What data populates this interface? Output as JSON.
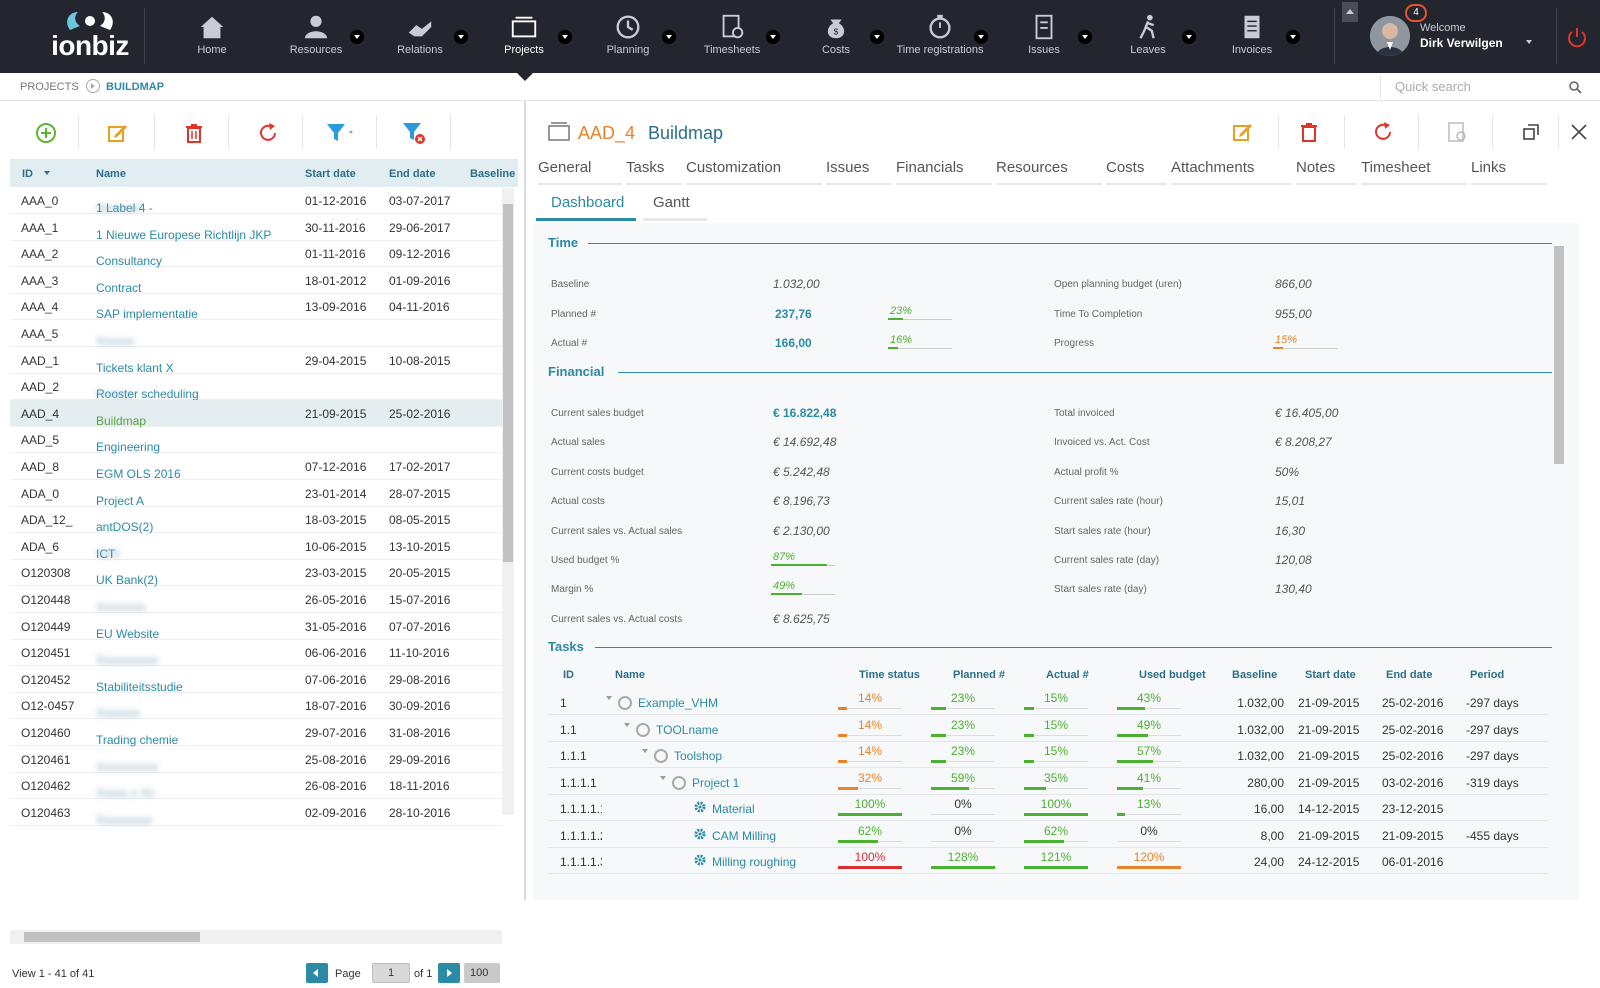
{
  "app": {
    "logo_text": "ionbiz"
  },
  "nav": [
    {
      "label": "Home",
      "icon": "home-icon"
    },
    {
      "label": "Resources",
      "icon": "users-icon"
    },
    {
      "label": "Relations",
      "icon": "handshake-icon"
    },
    {
      "label": "Projects",
      "icon": "folders-icon"
    },
    {
      "label": "Planning",
      "icon": "clock-icon"
    },
    {
      "label": "Timesheets",
      "icon": "timesheet-icon"
    },
    {
      "label": "Costs",
      "icon": "money-bag-icon"
    },
    {
      "label": "Time registrations",
      "icon": "stopwatch-icon"
    },
    {
      "label": "Issues",
      "icon": "issues-icon"
    },
    {
      "label": "Leaves",
      "icon": "walking-person-icon"
    },
    {
      "label": "Invoices",
      "icon": "invoice-icon"
    }
  ],
  "user": {
    "welcome": "Welcome",
    "name": "Dirk Verwilgen",
    "notifications": "4"
  },
  "breadcrumb": {
    "root": "PROJECTS",
    "current": "BUILDMAP"
  },
  "search": {
    "placeholder": "Quick search"
  },
  "list": {
    "columns": {
      "id": "ID",
      "name": "Name",
      "start": "Start date",
      "end": "End date",
      "baseline": "Baseline"
    },
    "rows": [
      {
        "id": "AAA_0",
        "name": "1 Label 4 -",
        "blur": "Xxxxxxx",
        "start": "01-12-2016",
        "end": "03-07-2017"
      },
      {
        "id": "AAA_1",
        "name": "1 Nieuwe Europese Richtlijn JKP",
        "blur": "",
        "start": "30-11-2016",
        "end": "29-06-2017"
      },
      {
        "id": "AAA_2",
        "name": "Consultancy",
        "blur": "",
        "start": "01-11-2016",
        "end": "09-12-2016"
      },
      {
        "id": "AAA_3",
        "name": "Contract",
        "blur": "",
        "start": "18-01-2012",
        "end": "01-09-2016"
      },
      {
        "id": "AAA_4",
        "name": "SAP implementatie",
        "blur": "",
        "start": "13-09-2016",
        "end": "04-11-2016"
      },
      {
        "id": "AAA_5",
        "name": "",
        "blur": "Xxxxxx",
        "start": "",
        "end": ""
      },
      {
        "id": "AAD_1",
        "name": "Tickets klant X",
        "blur": "",
        "start": "29-04-2015",
        "end": "10-08-2015"
      },
      {
        "id": "AAD_2",
        "name": "Rooster scheduling",
        "blur": "Xxxxxx",
        "start": "",
        "end": ""
      },
      {
        "id": "AAD_4",
        "name": "Buildmap",
        "blur": "",
        "start": "21-09-2015",
        "end": "25-02-2016",
        "selected": true
      },
      {
        "id": "AAD_5",
        "name": "Engineering",
        "blur": "",
        "start": "",
        "end": ""
      },
      {
        "id": "AAD_8",
        "name": "EGM OLS 2016",
        "blur": "",
        "start": "07-12-2016",
        "end": "17-02-2017"
      },
      {
        "id": "ADA_0",
        "name": "Project A",
        "blur": "",
        "start": "23-01-2014",
        "end": "28-07-2015"
      },
      {
        "id": "ADA_12_",
        "name": "antDOS(2)",
        "blur": "",
        "start": "18-03-2015",
        "end": "08-05-2015"
      },
      {
        "id": "ADA_6",
        "name": "ICT",
        "blur": "XXX",
        "start": "10-06-2015",
        "end": "13-10-2015"
      },
      {
        "id": "O120308",
        "name": "UK Bank(2)",
        "blur": "",
        "start": "23-03-2015",
        "end": "20-05-2015"
      },
      {
        "id": "O120448",
        "name": "",
        "blur": "Xxxxxxxx",
        "start": "26-05-2016",
        "end": "15-07-2016"
      },
      {
        "id": "O120449",
        "name": "EU Website",
        "blur": "",
        "start": "31-05-2016",
        "end": "07-07-2016"
      },
      {
        "id": "O120451",
        "name": "",
        "blur": "Xxxxxxxxxx",
        "start": "06-06-2016",
        "end": "11-10-2016"
      },
      {
        "id": "O120452",
        "name": "Stabiliteitsstudie",
        "blur": "",
        "start": "07-06-2016",
        "end": "29-08-2016"
      },
      {
        "id": "O12-0457",
        "name": "",
        "blur": "Xxxxxxx",
        "start": "18-07-2016",
        "end": "30-09-2016"
      },
      {
        "id": "O120460",
        "name": "Trading chemie",
        "blur": "",
        "start": "29-07-2016",
        "end": "31-08-2016"
      },
      {
        "id": "O120461",
        "name": "",
        "blur": "Xxxxxxxxxx",
        "start": "25-08-2016",
        "end": "29-09-2016"
      },
      {
        "id": "O120462",
        "name": "",
        "blur": "Xxxxx x Xx",
        "start": "26-08-2016",
        "end": "18-11-2016"
      },
      {
        "id": "O120463",
        "name": "",
        "blur": "Xxxxxxxxx",
        "start": "02-09-2016",
        "end": "28-10-2016"
      }
    ],
    "pager": {
      "view": "View 1 - 41 of 41",
      "page_label": "Page",
      "page": "1",
      "of": "of 1",
      "page_size": "100"
    }
  },
  "detail": {
    "id": "AAD_4",
    "name": "Buildmap",
    "tabs": [
      "General",
      "Tasks",
      "Customization",
      "Issues",
      "Financials",
      "Resources",
      "Costs",
      "Attachments",
      "Notes",
      "Timesheet",
      "Links"
    ],
    "subtabs": [
      "Dashboard",
      "Gantt"
    ],
    "time": {
      "title": "Time",
      "baseline_label": "Baseline",
      "baseline": "1.032,00",
      "planned_label": "Planned #",
      "planned": "237,76",
      "planned_pct": "23%",
      "planned_pct_value": 23,
      "actual_label": "Actual #",
      "actual": "166,00",
      "actual_pct": "16%",
      "actual_pct_value": 16,
      "open_label": "Open planning budget (uren)",
      "open": "866,00",
      "ttc_label": "Time To Completion",
      "ttc": "955,00",
      "progress_label": "Progress",
      "progress": "15%",
      "progress_value": 15
    },
    "financial": {
      "title": "Financial",
      "csb_label": "Current sales budget",
      "csb": "€ 16.822,48",
      "as_label": "Actual sales",
      "as": "€ 14.692,48",
      "ccb_label": "Current costs budget",
      "ccb": "€ 5.242,48",
      "ac_label": "Actual costs",
      "ac": "€ 8.196,73",
      "csas_label": "Current sales vs. Actual sales",
      "csas": "€ 2.130,00",
      "ub_label": "Used budget %",
      "ub": "87%",
      "ub_value": 87,
      "m_label": "Margin %",
      "m": "49%",
      "m_value": 49,
      "csac_label": "Current sales vs. Actual costs",
      "csac": "€ 8.625,75",
      "ti_label": "Total invoiced",
      "ti": "€ 16.405,00",
      "iac_label": "Invoiced vs. Act. Cost",
      "iac": "€ 8.208,27",
      "ap_label": "Actual profit %",
      "ap": "50%",
      "csrh_label": "Current sales rate (hour)",
      "csrh": "15,01",
      "ssrh_label": "Start sales rate (hour)",
      "ssrh": "16,30",
      "csrd_label": "Current sales rate (day)",
      "csrd": "120,08",
      "ssrd_label": "Start sales rate (day)",
      "ssrd": "130,40"
    },
    "tasks": {
      "title": "Tasks",
      "columns": {
        "id": "ID",
        "name": "Name",
        "ts": "Time status",
        "pl": "Planned #",
        "ac": "Actual #",
        "ub": "Used budget",
        "bl": "Baseline",
        "sd": "Start date",
        "ed": "End date",
        "pe": "Period"
      },
      "rows": [
        {
          "id": "1",
          "name": "Example_VHM",
          "ts": "14%",
          "tsv": 14,
          "tsc": "orange",
          "pl": "23%",
          "plv": 23,
          "plc": "green",
          "ac": "15%",
          "acv": 15,
          "acc": "green",
          "ub": "43%",
          "ubv": 43,
          "ubc": "green",
          "bl": "1.032,00",
          "sd": "21-09-2015",
          "ed": "25-02-2016",
          "pe": "-297 days",
          "level": 0,
          "type": "group"
        },
        {
          "id": "1.1",
          "name": "TOOLname",
          "ts": "14%",
          "tsv": 14,
          "tsc": "orange",
          "pl": "23%",
          "plv": 23,
          "plc": "green",
          "ac": "15%",
          "acv": 15,
          "acc": "green",
          "ub": "49%",
          "ubv": 49,
          "ubc": "green",
          "bl": "1.032,00",
          "sd": "21-09-2015",
          "ed": "25-02-2016",
          "pe": "-297 days",
          "level": 1,
          "type": "group"
        },
        {
          "id": "1.1.1",
          "name": "Toolshop",
          "ts": "14%",
          "tsv": 14,
          "tsc": "orange",
          "pl": "23%",
          "plv": 23,
          "plc": "green",
          "ac": "15%",
          "acv": 15,
          "acc": "green",
          "ub": "57%",
          "ubv": 57,
          "ubc": "green",
          "bl": "1.032,00",
          "sd": "21-09-2015",
          "ed": "25-02-2016",
          "pe": "-297 days",
          "level": 2,
          "type": "group"
        },
        {
          "id": "1.1.1.1",
          "name": "Project 1",
          "ts": "32%",
          "tsv": 32,
          "tsc": "orange",
          "pl": "59%",
          "plv": 59,
          "plc": "green",
          "ac": "35%",
          "acv": 35,
          "acc": "green",
          "ub": "41%",
          "ubv": 41,
          "ubc": "green",
          "bl": "280,00",
          "sd": "21-09-2015",
          "ed": "03-02-2016",
          "pe": "-319 days",
          "level": 3,
          "type": "group"
        },
        {
          "id": "1.1.1.1.1",
          "name": "Material",
          "ts": "100%",
          "tsv": 100,
          "tsc": "green",
          "pl": "0%",
          "plv": 0,
          "plc": "plain",
          "ac": "100%",
          "acv": 100,
          "acc": "green",
          "ub": "13%",
          "ubv": 13,
          "ubc": "green",
          "bl": "16,00",
          "sd": "14-12-2015",
          "ed": "23-12-2015",
          "pe": "",
          "level": 4,
          "type": "task"
        },
        {
          "id": "1.1.1.1.2",
          "name": "CAM Milling",
          "ts": "62%",
          "tsv": 62,
          "tsc": "green",
          "pl": "0%",
          "plv": 0,
          "plc": "plain",
          "ac": "62%",
          "acv": 62,
          "acc": "green",
          "ub": "0%",
          "ubv": 0,
          "ubc": "plain",
          "bl": "8,00",
          "sd": "21-09-2015",
          "ed": "21-09-2015",
          "pe": "-455 days",
          "level": 4,
          "type": "task"
        },
        {
          "id": "1.1.1.1.3",
          "name": "Milling roughing",
          "ts": "100%",
          "tsv": 100,
          "tsc": "red",
          "pl": "128%",
          "plv": 100,
          "plc": "green",
          "ac": "121%",
          "acv": 100,
          "acc": "green",
          "ub": "120%",
          "ubv": 100,
          "ubc": "orange",
          "bl": "24,00",
          "sd": "24-12-2015",
          "ed": "06-01-2016",
          "pe": "",
          "level": 4,
          "type": "task"
        }
      ]
    }
  }
}
